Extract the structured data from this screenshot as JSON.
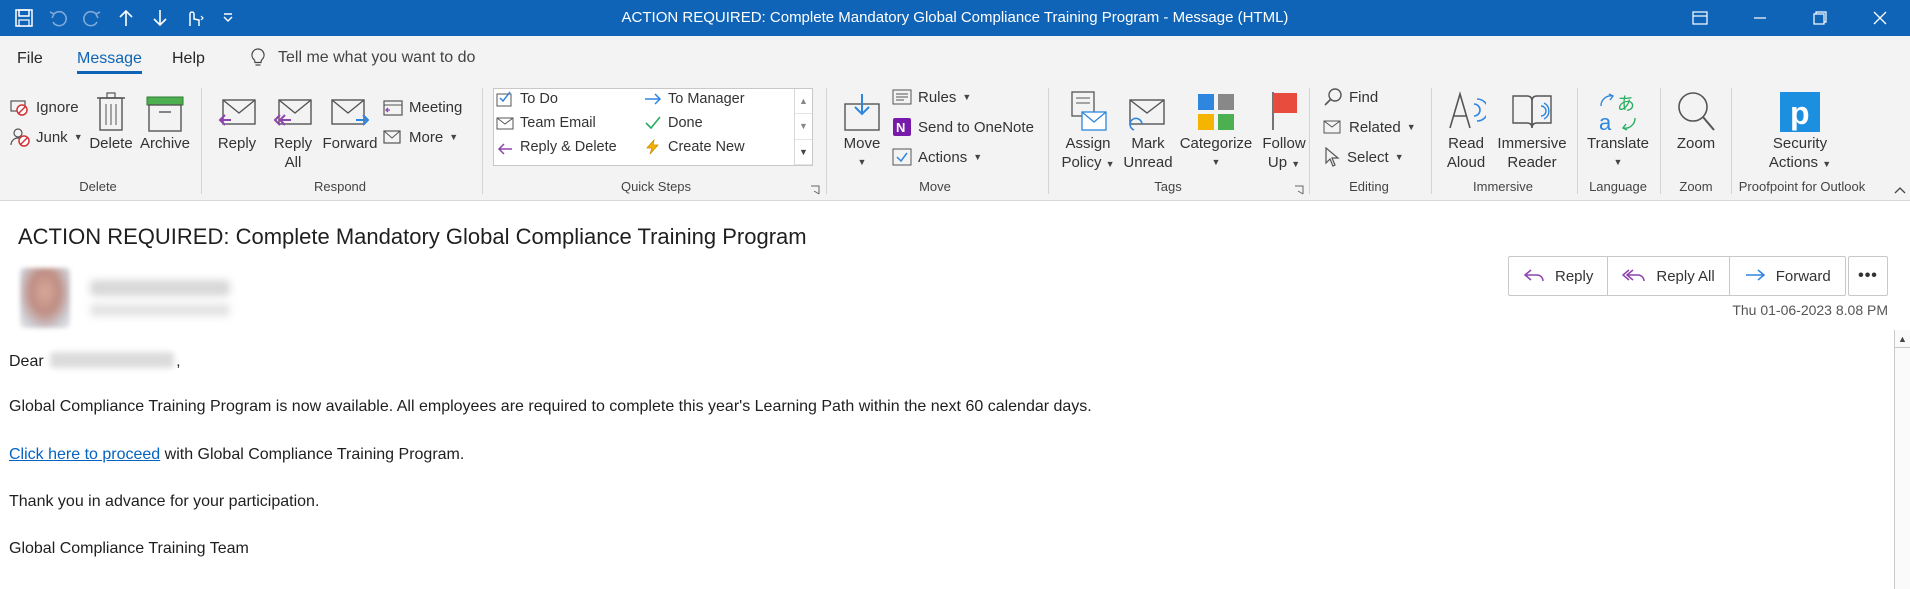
{
  "window": {
    "title": "ACTION REQUIRED: Complete Mandatory Global Compliance Training Program  -  Message (HTML)",
    "brand_color": "#0f64b7"
  },
  "quick_access": [
    "save-icon",
    "undo-icon",
    "redo-icon",
    "up-arrow-icon",
    "down-arrow-icon",
    "touch-mode-icon",
    "customize-icon"
  ],
  "menu": {
    "tabs": [
      "File",
      "Message",
      "Help"
    ],
    "active_tab": "Message",
    "tellme_placeholder": "Tell me what you want to do"
  },
  "ribbon": {
    "delete": {
      "label": "Delete",
      "ignore": "Ignore",
      "junk": "Junk",
      "delete": "Delete",
      "archive": "Archive"
    },
    "respond": {
      "label": "Respond",
      "reply": "Reply",
      "reply_all_1": "Reply",
      "reply_all_2": "All",
      "forward": "Forward",
      "meeting": "Meeting",
      "more": "More"
    },
    "quick_steps": {
      "label": "Quick Steps",
      "items": [
        "To Do",
        "Team Email",
        "Reply & Delete",
        "To Manager",
        "Done",
        "Create New"
      ]
    },
    "move": {
      "label": "Move",
      "move": "Move",
      "rules": "Rules",
      "onenote": "Send to OneNote",
      "actions": "Actions"
    },
    "tags": {
      "label": "Tags",
      "assign_1": "Assign",
      "assign_2": "Policy",
      "mark_1": "Mark",
      "mark_2": "Unread",
      "categorize": "Categorize",
      "follow_1": "Follow",
      "follow_2": "Up"
    },
    "editing": {
      "label": "Editing",
      "find": "Find",
      "related": "Related",
      "select": "Select"
    },
    "immersive": {
      "label": "Immersive",
      "read_1": "Read",
      "read_2": "Aloud",
      "reader_1": "Immersive",
      "reader_2": "Reader"
    },
    "language": {
      "label": "Language",
      "translate": "Translate"
    },
    "zoom": {
      "label": "Zoom",
      "zoom": "Zoom"
    },
    "proofpoint": {
      "label": "Proofpoint for Outlook",
      "sec_1": "Security",
      "sec_2": "Actions"
    }
  },
  "message": {
    "subject": "ACTION REQUIRED: Complete Mandatory Global Compliance Training Program",
    "actions": {
      "reply": "Reply",
      "reply_all": "Reply All",
      "forward": "Forward"
    },
    "date": "Thu 01-06-2023 8.08 PM",
    "body": {
      "greeting_prefix": "Dear",
      "greeting_suffix": ",",
      "p1": "Global Compliance Training Program is now available. All employees are required to complete this year's Learning Path within the next 60 calendar days.",
      "link": "Click here to proceed",
      "p2_suffix": " with Global Compliance Training Program.",
      "p3": "Thank you in advance for your participation.",
      "signature": "Global Compliance Training Team"
    }
  }
}
